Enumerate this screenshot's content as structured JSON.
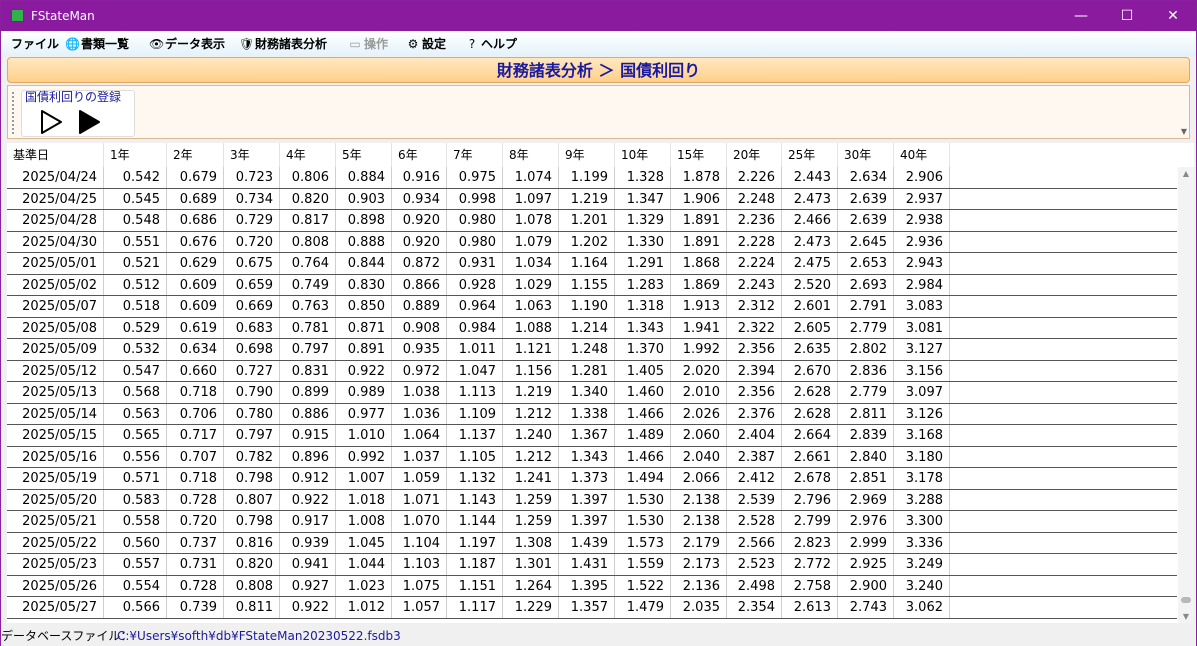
{
  "window": {
    "title": "FStateMan",
    "minimize": "—",
    "maximize": "☐",
    "close": "✕"
  },
  "menu": {
    "file": "ファイル",
    "documents": {
      "icon": "globe-icon",
      "label": "書類一覧"
    },
    "data_view": {
      "icon": "eye-icon",
      "label": "データ表示"
    },
    "financial_analysis": {
      "icon": "shield-icon",
      "label": "財務諸表分析"
    },
    "operations": {
      "icon": "image-icon",
      "label": "操作"
    },
    "settings": {
      "icon": "gear-icon",
      "label": "設定"
    },
    "help": {
      "icon": "question-icon",
      "label": "ヘルプ"
    }
  },
  "page": {
    "title": "財務諸表分析 ＞ 国債利回り"
  },
  "actions": {
    "group_label": "国債利回りの登録",
    "run_outline_icon": "play-outline-icon",
    "run_filled_icon": "play-filled-icon"
  },
  "table": {
    "columns": [
      "基準日",
      "1年",
      "2年",
      "3年",
      "4年",
      "5年",
      "6年",
      "7年",
      "8年",
      "9年",
      "10年",
      "15年",
      "20年",
      "25年",
      "30年",
      "40年"
    ],
    "rows": [
      [
        "2025/04/24",
        "0.542",
        "0.679",
        "0.723",
        "0.806",
        "0.884",
        "0.916",
        "0.975",
        "1.074",
        "1.199",
        "1.328",
        "1.878",
        "2.226",
        "2.443",
        "2.634",
        "2.906"
      ],
      [
        "2025/04/25",
        "0.545",
        "0.689",
        "0.734",
        "0.820",
        "0.903",
        "0.934",
        "0.998",
        "1.097",
        "1.219",
        "1.347",
        "1.906",
        "2.248",
        "2.473",
        "2.639",
        "2.937"
      ],
      [
        "2025/04/28",
        "0.548",
        "0.686",
        "0.729",
        "0.817",
        "0.898",
        "0.920",
        "0.980",
        "1.078",
        "1.201",
        "1.329",
        "1.891",
        "2.236",
        "2.466",
        "2.639",
        "2.938"
      ],
      [
        "2025/04/30",
        "0.551",
        "0.676",
        "0.720",
        "0.808",
        "0.888",
        "0.920",
        "0.980",
        "1.079",
        "1.202",
        "1.330",
        "1.891",
        "2.228",
        "2.473",
        "2.645",
        "2.936"
      ],
      [
        "2025/05/01",
        "0.521",
        "0.629",
        "0.675",
        "0.764",
        "0.844",
        "0.872",
        "0.931",
        "1.034",
        "1.164",
        "1.291",
        "1.868",
        "2.224",
        "2.475",
        "2.653",
        "2.943"
      ],
      [
        "2025/05/02",
        "0.512",
        "0.609",
        "0.659",
        "0.749",
        "0.830",
        "0.866",
        "0.928",
        "1.029",
        "1.155",
        "1.283",
        "1.869",
        "2.243",
        "2.520",
        "2.693",
        "2.984"
      ],
      [
        "2025/05/07",
        "0.518",
        "0.609",
        "0.669",
        "0.763",
        "0.850",
        "0.889",
        "0.964",
        "1.063",
        "1.190",
        "1.318",
        "1.913",
        "2.312",
        "2.601",
        "2.791",
        "3.083"
      ],
      [
        "2025/05/08",
        "0.529",
        "0.619",
        "0.683",
        "0.781",
        "0.871",
        "0.908",
        "0.984",
        "1.088",
        "1.214",
        "1.343",
        "1.941",
        "2.322",
        "2.605",
        "2.779",
        "3.081"
      ],
      [
        "2025/05/09",
        "0.532",
        "0.634",
        "0.698",
        "0.797",
        "0.891",
        "0.935",
        "1.011",
        "1.121",
        "1.248",
        "1.370",
        "1.992",
        "2.356",
        "2.635",
        "2.802",
        "3.127"
      ],
      [
        "2025/05/12",
        "0.547",
        "0.660",
        "0.727",
        "0.831",
        "0.922",
        "0.972",
        "1.047",
        "1.156",
        "1.281",
        "1.405",
        "2.020",
        "2.394",
        "2.670",
        "2.836",
        "3.156"
      ],
      [
        "2025/05/13",
        "0.568",
        "0.718",
        "0.790",
        "0.899",
        "0.989",
        "1.038",
        "1.113",
        "1.219",
        "1.340",
        "1.460",
        "2.010",
        "2.356",
        "2.628",
        "2.779",
        "3.097"
      ],
      [
        "2025/05/14",
        "0.563",
        "0.706",
        "0.780",
        "0.886",
        "0.977",
        "1.036",
        "1.109",
        "1.212",
        "1.338",
        "1.466",
        "2.026",
        "2.376",
        "2.628",
        "2.811",
        "3.126"
      ],
      [
        "2025/05/15",
        "0.565",
        "0.717",
        "0.797",
        "0.915",
        "1.010",
        "1.064",
        "1.137",
        "1.240",
        "1.367",
        "1.489",
        "2.060",
        "2.404",
        "2.664",
        "2.839",
        "3.168"
      ],
      [
        "2025/05/16",
        "0.556",
        "0.707",
        "0.782",
        "0.896",
        "0.992",
        "1.037",
        "1.105",
        "1.212",
        "1.343",
        "1.466",
        "2.040",
        "2.387",
        "2.661",
        "2.840",
        "3.180"
      ],
      [
        "2025/05/19",
        "0.571",
        "0.718",
        "0.798",
        "0.912",
        "1.007",
        "1.059",
        "1.132",
        "1.241",
        "1.373",
        "1.494",
        "2.066",
        "2.412",
        "2.678",
        "2.851",
        "3.178"
      ],
      [
        "2025/05/20",
        "0.583",
        "0.728",
        "0.807",
        "0.922",
        "1.018",
        "1.071",
        "1.143",
        "1.259",
        "1.397",
        "1.530",
        "2.138",
        "2.539",
        "2.796",
        "2.969",
        "3.288"
      ],
      [
        "2025/05/21",
        "0.558",
        "0.720",
        "0.798",
        "0.917",
        "1.008",
        "1.070",
        "1.144",
        "1.259",
        "1.397",
        "1.530",
        "2.138",
        "2.528",
        "2.799",
        "2.976",
        "3.300"
      ],
      [
        "2025/05/22",
        "0.560",
        "0.737",
        "0.816",
        "0.939",
        "1.045",
        "1.104",
        "1.197",
        "1.308",
        "1.439",
        "1.573",
        "2.179",
        "2.566",
        "2.823",
        "2.999",
        "3.336"
      ],
      [
        "2025/05/23",
        "0.557",
        "0.731",
        "0.820",
        "0.941",
        "1.044",
        "1.103",
        "1.187",
        "1.301",
        "1.431",
        "1.559",
        "2.173",
        "2.523",
        "2.772",
        "2.925",
        "3.249"
      ],
      [
        "2025/05/26",
        "0.554",
        "0.728",
        "0.808",
        "0.927",
        "1.023",
        "1.075",
        "1.151",
        "1.264",
        "1.395",
        "1.522",
        "2.136",
        "2.498",
        "2.758",
        "2.900",
        "3.240"
      ],
      [
        "2025/05/27",
        "0.566",
        "0.739",
        "0.811",
        "0.922",
        "1.012",
        "1.057",
        "1.117",
        "1.229",
        "1.357",
        "1.479",
        "2.035",
        "2.354",
        "2.613",
        "2.743",
        "3.062"
      ]
    ]
  },
  "status": {
    "label": "データベースファイル：",
    "value": "C:¥Users¥softh¥db¥FStateMan20230522.fsdb3"
  }
}
